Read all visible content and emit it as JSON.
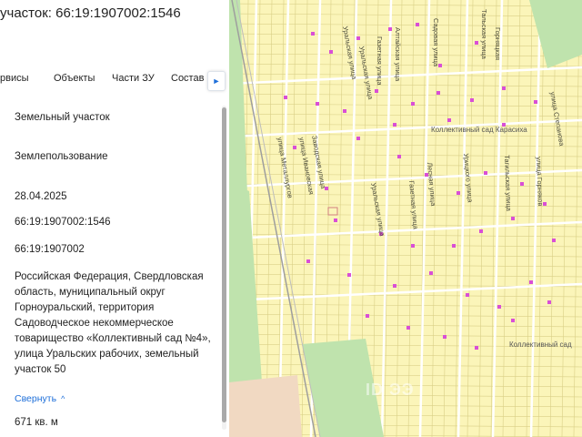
{
  "header": {
    "title": "участок: 66:19:1907002:1546"
  },
  "tabs": [
    {
      "label": "рвисы"
    },
    {
      "label": "Объекты"
    },
    {
      "label": "Части ЗУ"
    },
    {
      "label": "Состав"
    }
  ],
  "tab_scroll_icon": "chevron-right-icon",
  "info": {
    "object_type": "Земельный участок",
    "category": "Землепользование",
    "date": "28.04.2025",
    "cadastral_number": "66:19:1907002:1546",
    "quarter": "66:19:1907002",
    "address": "Российская Федерация, Свердловская область, муниципальный округ Горноуральский, территория Садоводческое некоммерческое товарищество «Коллективный сад №4», улица Уральских рабочих, земельный участок 50",
    "collapse_label": "Свернуть",
    "area": "671 кв. м"
  },
  "map": {
    "colors": {
      "plots": "#fbf5b9",
      "grid": "#d9cf86",
      "forest": "#bfe3ad",
      "road": "#ffffff",
      "marker": "#d94fd6"
    },
    "streets": [
      "Тальская улица",
      "Горняцкая",
      "Садовая улица",
      "Алтайская улица",
      "Уральская улица",
      "Газетная улица",
      "Уральская улица",
      "улица Степанова",
      "Заводская улица",
      "улица Ивановская",
      "улица Металлургов",
      "Уральская улица",
      "Газетная улица",
      "Лесная улица",
      "Урицкого улица",
      "Тагильская улица",
      "улица Горняков"
    ],
    "districts": [
      "Коллективный сад Карасиха",
      "Коллективный сад"
    ],
    "watermark": "ID ЭЭ"
  }
}
